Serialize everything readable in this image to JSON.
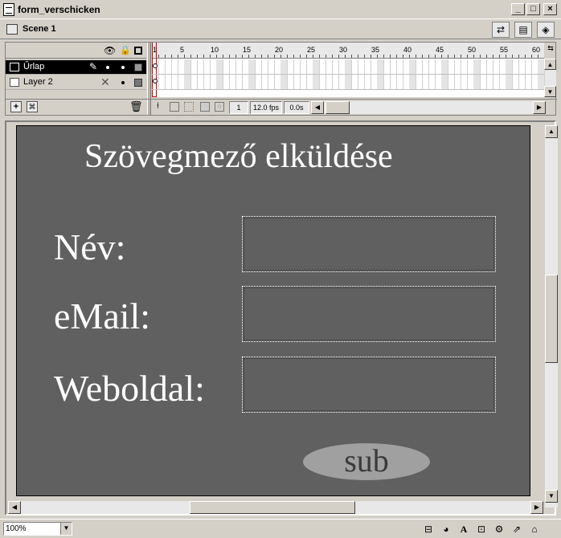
{
  "window": {
    "title": "form_verschicken",
    "controls": {
      "minimize": "_",
      "maximize": "□",
      "close": "×"
    }
  },
  "scenebar": {
    "scene_label": "Scene 1"
  },
  "timeline": {
    "header_icons": [
      "eye-icon",
      "lock-icon",
      "outline-square-icon"
    ],
    "layers": [
      {
        "name": "Űrlap",
        "selected": true
      },
      {
        "name": "Layer 2",
        "selected": false
      }
    ],
    "ruler_numbers": [
      "1",
      "5",
      "10",
      "15",
      "20",
      "25",
      "30",
      "35",
      "40",
      "45",
      "50",
      "55",
      "60"
    ],
    "current_frame": "1",
    "frame_rate": "12.0 fps",
    "elapsed_time": "0.0s"
  },
  "stage": {
    "heading": "Szövegmező elküldése",
    "fields": [
      {
        "label": "Név:"
      },
      {
        "label": "eMail:"
      },
      {
        "label": "Weboldal:"
      }
    ],
    "submit_label": "sub",
    "background_color": "#606060",
    "button_color": "#a0a0a0"
  },
  "statusbar": {
    "zoom": "100%"
  }
}
